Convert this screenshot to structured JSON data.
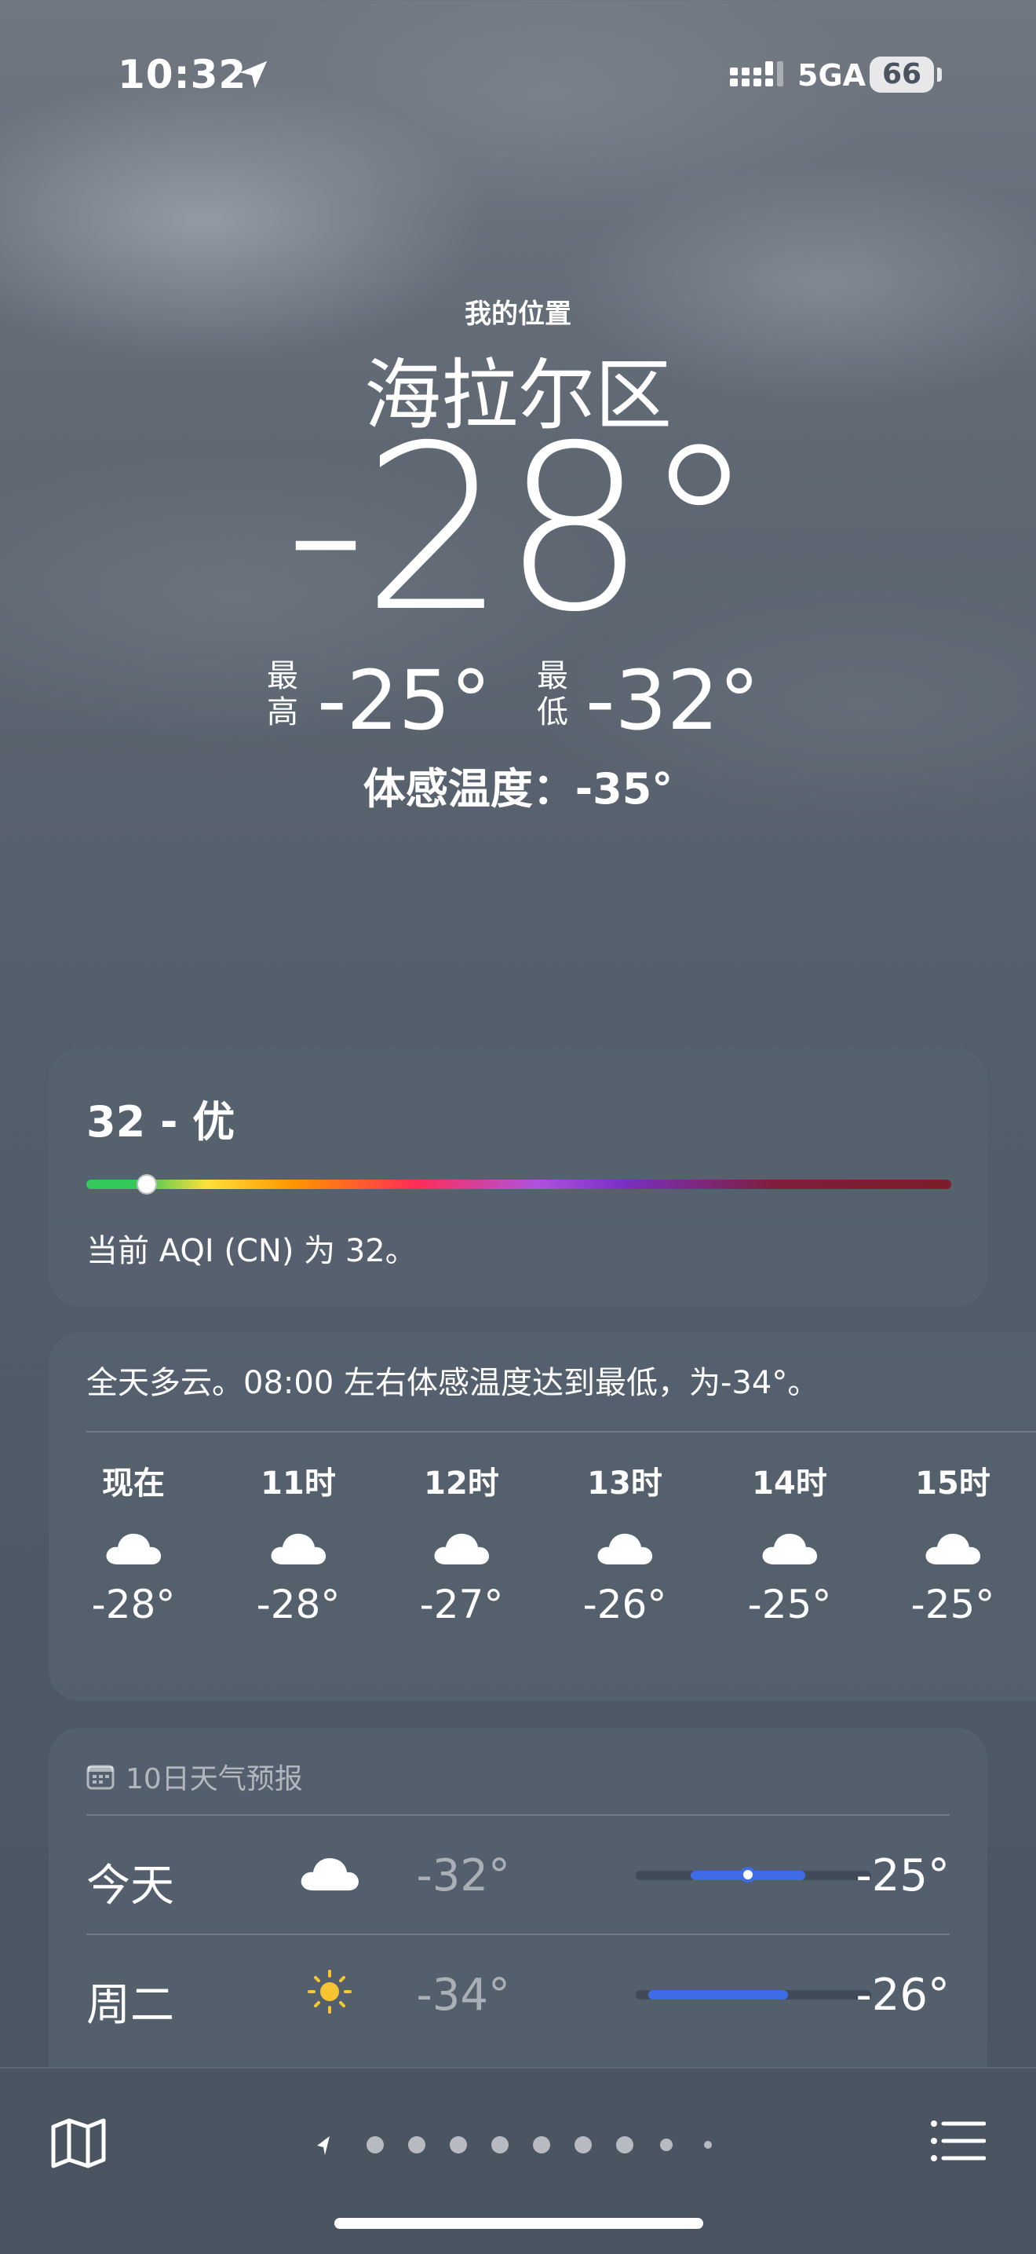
{
  "status": {
    "time": "10:32",
    "network": "5GA",
    "battery": "66"
  },
  "location": {
    "subtitle": "我的位置",
    "city": "海拉尔区",
    "temp": "-28°",
    "high_label_1": "最",
    "high_label_2": "高",
    "high": "-25°",
    "low_label_1": "最",
    "low_label_2": "低",
    "low": "-32°",
    "feels_like": "体感温度：-35°"
  },
  "aqi": {
    "value": "32 - 优",
    "level_fraction": 0.07,
    "desc": "当前 AQI (CN) 为 32。"
  },
  "hourly": {
    "summary": "全天多云。08:00 左右体感温度达到最低，为-34°。",
    "items": [
      {
        "label": "现在",
        "icon": "cloud-icon",
        "temp": "-28°"
      },
      {
        "label": "11时",
        "icon": "cloud-icon",
        "temp": "-28°"
      },
      {
        "label": "12时",
        "icon": "cloud-icon",
        "temp": "-27°"
      },
      {
        "label": "13时",
        "icon": "cloud-icon",
        "temp": "-26°"
      },
      {
        "label": "14时",
        "icon": "cloud-icon",
        "temp": "-25°"
      },
      {
        "label": "15时",
        "icon": "cloud-icon",
        "temp": "-25°"
      }
    ]
  },
  "forecast": {
    "header": "10日天气预报",
    "header_icon": "calendar-icon",
    "days": [
      {
        "day": "今天",
        "icon": "cloud-icon",
        "low": "-32°",
        "high": "-25°"
      },
      {
        "day": "周二",
        "icon": "sun-icon",
        "low": "-34°",
        "high": "-26°"
      }
    ]
  },
  "bottom": {
    "map_icon": "map-icon",
    "list_icon": "list-icon",
    "pages": 9,
    "current_page_icon": "location-arrow-icon"
  },
  "colors": {
    "sun": "#f7c531",
    "range_bar": "#3e6be6",
    "aqi_good": "#34c759"
  }
}
